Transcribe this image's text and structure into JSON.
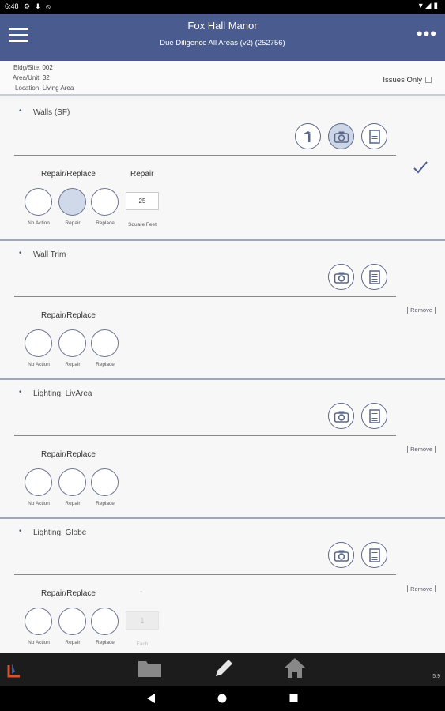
{
  "status": {
    "time": "6:48",
    "icons_right": "▾◢▮"
  },
  "header": {
    "title": "Fox Hall Manor",
    "subtitle": "Due Diligence All Areas (v2) (252756)"
  },
  "info": {
    "bldg_label": "Bldg/Site:",
    "bldg_value": "002",
    "area_label": "Area/Unit:",
    "area_value": "32",
    "location_label": "Location:",
    "location_value": "Living Area",
    "issues_only_label": "Issues Only"
  },
  "items": [
    {
      "title": "Walls (SF)",
      "group_label": "Repair/Replace",
      "qty_header": "Repair",
      "qty_value": "25",
      "unit_label": "Square Feet",
      "options": [
        "No Action",
        "Repair",
        "Replace"
      ]
    },
    {
      "title": "Wall Trim",
      "group_label": "Repair/Replace",
      "options": [
        "No Action",
        "Repair",
        "Replace"
      ],
      "remove_label": "Remove"
    },
    {
      "title": "Lighting, LivArea",
      "group_label": "Repair/Replace",
      "options": [
        "No Action",
        "Repair",
        "Replace"
      ],
      "remove_label": "Remove"
    },
    {
      "title": "Lighting, Globe",
      "group_label": "Repair/Replace",
      "qty_header": "-",
      "qty_value": "1",
      "unit_label": "Each",
      "options": [
        "No Action",
        "Repair",
        "Replace"
      ],
      "remove_label": "Remove"
    }
  ],
  "footer": {
    "version": "5.9"
  },
  "colors": {
    "header_bg": "#4a5b8f",
    "selected_fill": "#cfd9ea",
    "accent": "#4a5b8f"
  },
  "icons": {
    "menu": "hamburger-icon",
    "more": "more-vert-icon",
    "tool": "hammer-icon",
    "camera": "camera-icon",
    "notes": "notes-icon"
  }
}
